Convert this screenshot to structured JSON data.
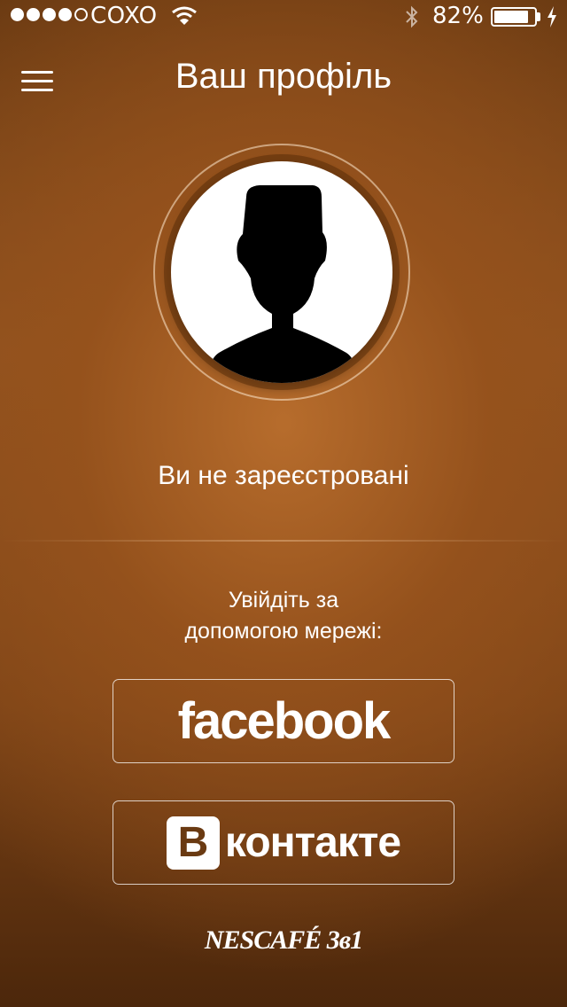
{
  "status_bar": {
    "carrier": "COXO",
    "battery_percent": "82%",
    "signal_bars": 4,
    "signal_total": 5,
    "battery_level": 0.82
  },
  "header": {
    "title": "Ваш профіль",
    "menu_icon": "hamburger-menu-icon"
  },
  "profile": {
    "avatar_icon": "user-silhouette-icon",
    "status_text": "Ви не зареєстровані"
  },
  "login": {
    "prompt_line1": "Увійдіть за",
    "prompt_line2": "допомогою мережі:",
    "facebook_label": "facebook",
    "vk_logo_letter": "B",
    "vk_label": "контакте"
  },
  "brand": {
    "logo_text": "NESCAFÉ 3в1"
  },
  "colors": {
    "background": "#8f5220",
    "text": "#ffffff"
  }
}
